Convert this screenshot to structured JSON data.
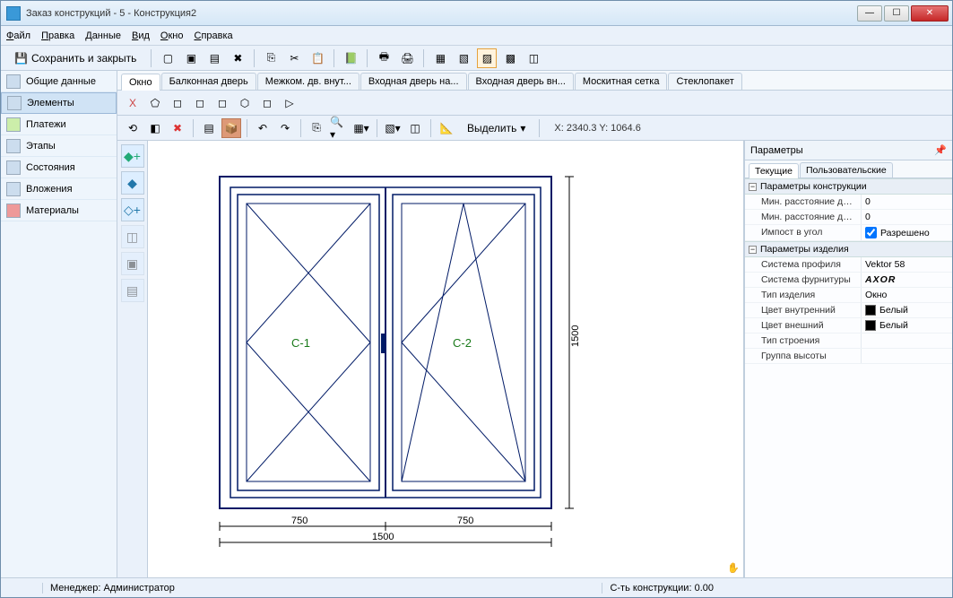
{
  "title": "Заказ конструкций - 5 - Конструкция2",
  "menu": {
    "file": "Файл",
    "edit": "Правка",
    "data": "Данные",
    "view": "Вид",
    "window": "Окно",
    "help": "Справка"
  },
  "toolbar": {
    "save_close": "Сохранить и закрыть"
  },
  "leftnav": {
    "items": [
      {
        "label": "Общие данные"
      },
      {
        "label": "Элементы"
      },
      {
        "label": "Платежи"
      },
      {
        "label": "Этапы"
      },
      {
        "label": "Состояния"
      },
      {
        "label": "Вложения"
      },
      {
        "label": "Материалы"
      }
    ]
  },
  "tabs": [
    {
      "label": "Окно"
    },
    {
      "label": "Балконная дверь"
    },
    {
      "label": "Межком. дв. внут..."
    },
    {
      "label": "Входная дверь на..."
    },
    {
      "label": "Входная дверь вн..."
    },
    {
      "label": "Москитная сетка"
    },
    {
      "label": "Стеклопакет"
    }
  ],
  "subtoolbar": {
    "select": "Выделить",
    "coords": "X: 2340.3  Y: 1064.6"
  },
  "drawing": {
    "sash1": "С-1",
    "sash2": "С-2",
    "dim_half": "750",
    "dim_width": "1500",
    "dim_height": "1500"
  },
  "rightpanel": {
    "title": "Параметры",
    "tabs": [
      {
        "label": "Текущие"
      },
      {
        "label": "Пользовательские"
      }
    ],
    "group1": "Параметры конструкции",
    "rows1": [
      {
        "k": "Мин. расстояние для ба...",
        "v": "0"
      },
      {
        "k": "Мин. расстояние для ф...",
        "v": "0"
      },
      {
        "k": "Импост в угол",
        "v": "Разрешено",
        "check": true
      }
    ],
    "group2": "Параметры изделия",
    "rows2": [
      {
        "k": "Система профиля",
        "v": "Vektor 58"
      },
      {
        "k": "Система фурнитуры",
        "v": "AXOR",
        "logo": true
      },
      {
        "k": "Тип изделия",
        "v": "Окно"
      },
      {
        "k": "Цвет внутренний",
        "v": "Белый",
        "swatch": "#000"
      },
      {
        "k": "Цвет внешний",
        "v": "Белый",
        "swatch": "#000"
      },
      {
        "k": "Тип строения",
        "v": ""
      },
      {
        "k": "Группа высоты",
        "v": ""
      }
    ]
  },
  "status": {
    "manager_lbl": "Менеджер:",
    "manager": "Администратор",
    "cost_lbl": "С-ть конструкции:",
    "cost": "0.00"
  }
}
